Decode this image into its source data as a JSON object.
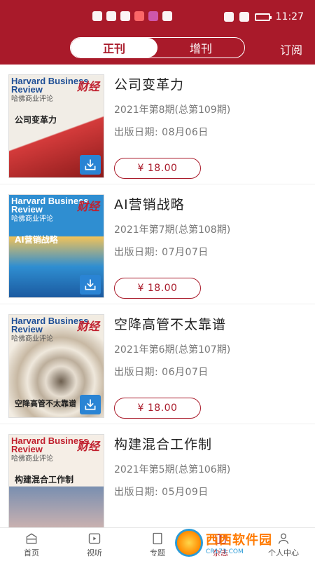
{
  "status": {
    "time": "11:27"
  },
  "header": {
    "tabs": [
      {
        "label": "正刊",
        "active": true
      },
      {
        "label": "增刊",
        "active": false
      }
    ],
    "subscribe_label": "订阅"
  },
  "issues": [
    {
      "title": "公司变革力",
      "issue": "2021年第8期(总第109期)",
      "date": "出版日期:  08月06日",
      "price": "¥ 18.00",
      "cover": {
        "hbr": "Harvard Business Review",
        "hbr_cn": "哈佛商业评论",
        "cj": "财经",
        "headline": "公司变革力"
      }
    },
    {
      "title": "AI营销战略",
      "issue": "2021年第7期(总第108期)",
      "date": "出版日期:  07月07日",
      "price": "¥ 18.00",
      "cover": {
        "hbr": "Harvard Business Review",
        "hbr_cn": "哈佛商业评论",
        "cj": "财经",
        "headline": "AI营销战略"
      }
    },
    {
      "title": "空降高管不太靠谱",
      "issue": "2021年第6期(总第107期)",
      "date": "出版日期:  06月07日",
      "price": "¥ 18.00",
      "cover": {
        "hbr": "Harvard Business Review",
        "hbr_cn": "哈佛商业评论",
        "cj": "财经",
        "headline": "空降高管不太靠谱"
      }
    },
    {
      "title": "构建混合工作制",
      "issue": "2021年第5期(总第106期)",
      "date": "出版日期:  05月09日",
      "price": "",
      "cover": {
        "hbr": "Harvard Business Review",
        "hbr_cn": "哈佛商业评论",
        "cj": "财经",
        "headline": "构建混合工作制"
      }
    }
  ],
  "bottom_nav": [
    {
      "label": "首页",
      "icon": "home-icon"
    },
    {
      "label": "视听",
      "icon": "video-icon"
    },
    {
      "label": "专题",
      "icon": "topic-icon"
    },
    {
      "label": "杂志",
      "icon": "magazine-icon"
    },
    {
      "label": "个人中心",
      "icon": "profile-icon"
    }
  ],
  "watermark": {
    "main": "西西软件园",
    "sub": "CR173.COM"
  },
  "colors": {
    "brand": "#a91a2a",
    "download": "#2a84d4"
  }
}
